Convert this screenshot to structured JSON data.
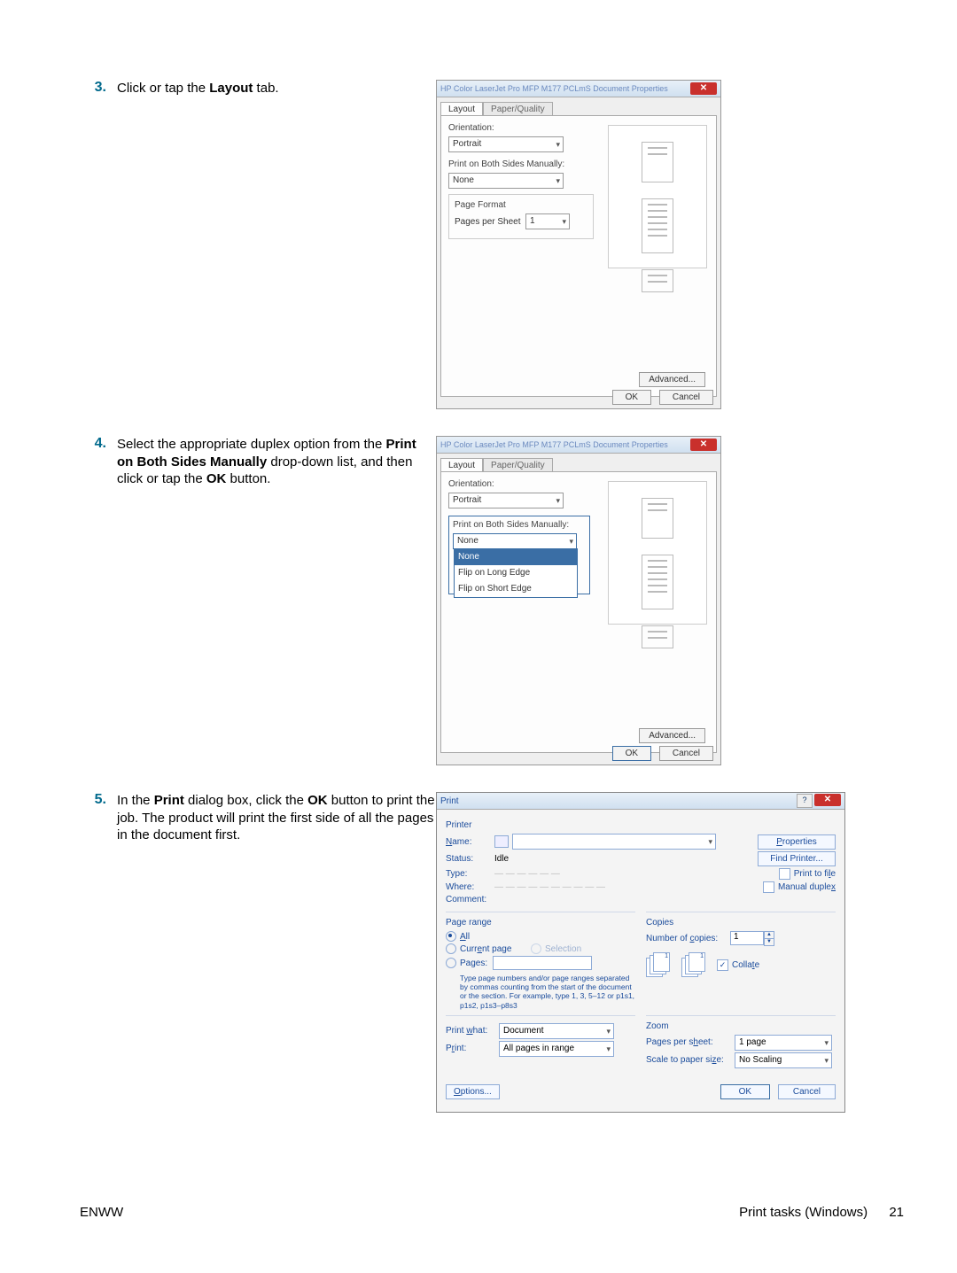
{
  "footer": {
    "left": "ENWW",
    "section": "Print tasks (Windows)",
    "page_num": "21"
  },
  "steps": {
    "s3": {
      "num": "3.",
      "pre": "Click or tap the ",
      "bold": "Layout",
      "post": " tab."
    },
    "s4": {
      "num": "4.",
      "t1": "Select the appropriate duplex option from the ",
      "b1": "Print on Both Sides Manually",
      "t2": " drop-down list, and then click or tap the ",
      "b2": "OK",
      "t3": " button."
    },
    "s5": {
      "num": "5.",
      "t1": "In the ",
      "b1": "Print",
      "t2": " dialog box, click the ",
      "b2": "OK",
      "t3": " button to print the job. The product will print the first side of all the pages in the document first."
    }
  },
  "dlg1": {
    "title": "HP Color LaserJet Pro MFP M177 PCLmS Document Properties",
    "tabLayout": "Layout",
    "tabPaper": "Paper/Quality",
    "orientation_lbl": "Orientation:",
    "orientation_val": "Portrait",
    "duplex_lbl": "Print on Both Sides Manually:",
    "duplex_val": "None",
    "pageformat_lbl": "Page Format",
    "pps_lbl": "Pages per Sheet",
    "pps_val": "1",
    "advanced": "Advanced...",
    "ok": "OK",
    "cancel": "Cancel"
  },
  "dlg2": {
    "title": "HP Color LaserJet Pro MFP M177 PCLmS Document Properties",
    "tabLayout": "Layout",
    "tabPaper": "Paper/Quality",
    "orientation_lbl": "Orientation:",
    "orientation_val": "Portrait",
    "duplex_lbl": "Print on Both Sides Manually:",
    "duplex_val": "None",
    "opt_none": "None",
    "opt_long": "Flip on Long Edge",
    "opt_short": "Flip on Short Edge",
    "advanced": "Advanced...",
    "ok": "OK",
    "cancel": "Cancel"
  },
  "pdlg": {
    "title": "Print",
    "printer": "Printer",
    "name_lbl": "Name:",
    "properties": "Properties",
    "status_lbl": "Status:",
    "status_val": "Idle",
    "type_lbl": "Type:",
    "where_lbl": "Where:",
    "comment_lbl": "Comment:",
    "find_printer": "Find Printer...",
    "print_to_file": "Print to file",
    "manual_duplex": "Manual duplex",
    "page_range": "Page range",
    "all": "All",
    "current": "Current page",
    "selection": "Selection",
    "pages": "Pages:",
    "pages_hint": "Type page numbers and/or page ranges separated by commas counting from the start of the document or the section. For example, type 1, 3, 5–12 or p1s1, p1s2, p1s3–p8s3",
    "copies": "Copies",
    "num_copies_lbl": "Number of copies:",
    "num_copies_val": "1",
    "collate": "Collate",
    "print_what_lbl": "Print what:",
    "print_what_val": "Document",
    "print_lbl": "Print:",
    "print_val": "All pages in range",
    "zoom": "Zoom",
    "pps_lbl": "Pages per sheet:",
    "pps_val": "1 page",
    "scale_lbl": "Scale to paper size:",
    "scale_val": "No Scaling",
    "options": "Options...",
    "ok": "OK",
    "cancel": "Cancel"
  }
}
